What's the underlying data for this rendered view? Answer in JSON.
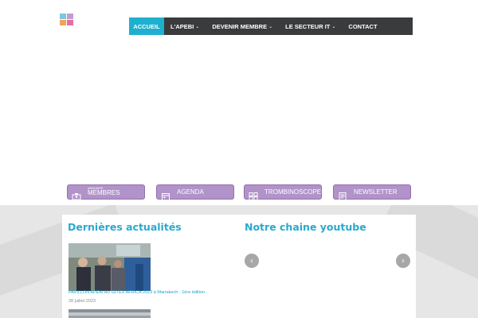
{
  "nav": {
    "items": [
      {
        "label": "ACCUEIL",
        "active": true,
        "dropdown": false
      },
      {
        "label": "L'APEBI",
        "active": false,
        "dropdown": true
      },
      {
        "label": "DEVENIR MEMBRE",
        "active": false,
        "dropdown": true
      },
      {
        "label": "LE SECTEUR IT",
        "active": false,
        "dropdown": true
      },
      {
        "label": "CONTACT",
        "active": false,
        "dropdown": false
      }
    ],
    "chevron": "⌄"
  },
  "quicklinks": [
    {
      "small": "ANNUAIRE",
      "label": "MEMBRES",
      "icon": "directory-icon"
    },
    {
      "label": "AGENDA",
      "icon": "calendar-icon"
    },
    {
      "label": "TROMBINOSCOPE",
      "icon": "grid-icon"
    },
    {
      "label": "NEWSLETTER",
      "icon": "newsletter-icon"
    }
  ],
  "news": {
    "heading": "Dernières actualités",
    "item_title": "PAVILLON APEBI AU GITEX AFRICA 2023 à Marrakech - 1ère édition",
    "item_date": "28 juillet 2023"
  },
  "youtube": {
    "heading": "Notre chaine youtube",
    "prev": "‹",
    "next": "›"
  },
  "colors": {
    "accent": "#1fb0cf",
    "nav_bg": "#3a3b3d",
    "button_bg": "#b193c9",
    "heading": "#29a9cf"
  }
}
